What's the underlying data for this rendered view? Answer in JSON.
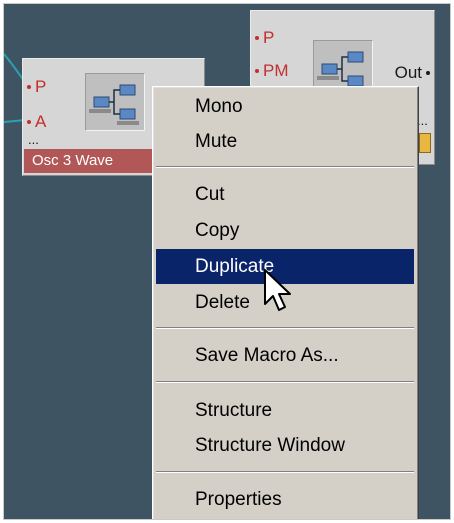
{
  "module_left": {
    "label": "Osc 3 Wave",
    "ports": [
      "P",
      "A"
    ],
    "ellipsis": "..."
  },
  "module_right": {
    "ports": [
      "P",
      "PM"
    ],
    "out_port": "Out",
    "ellipsis": "..."
  },
  "context_menu": {
    "items": [
      {
        "label": "Mono"
      },
      {
        "label": "Mute"
      },
      {
        "label": "Cut"
      },
      {
        "label": "Copy"
      },
      {
        "label": "Duplicate",
        "highlighted": true
      },
      {
        "label": "Delete"
      },
      {
        "label": "Save Macro As..."
      },
      {
        "label": "Structure"
      },
      {
        "label": "Structure Window"
      },
      {
        "label": "Properties"
      }
    ]
  },
  "colors": {
    "background": "#3f5462",
    "module_face": "#d6d6d6",
    "module_label_bg": "#b25757",
    "port_text": "#c22f2f",
    "wire": "#2aa0b0",
    "menu_face": "#d4d0c8",
    "menu_highlight": "#0a246a"
  },
  "icons": {
    "module_icon": "macro-structure-icon",
    "pointer": "arrow-cursor-icon"
  }
}
